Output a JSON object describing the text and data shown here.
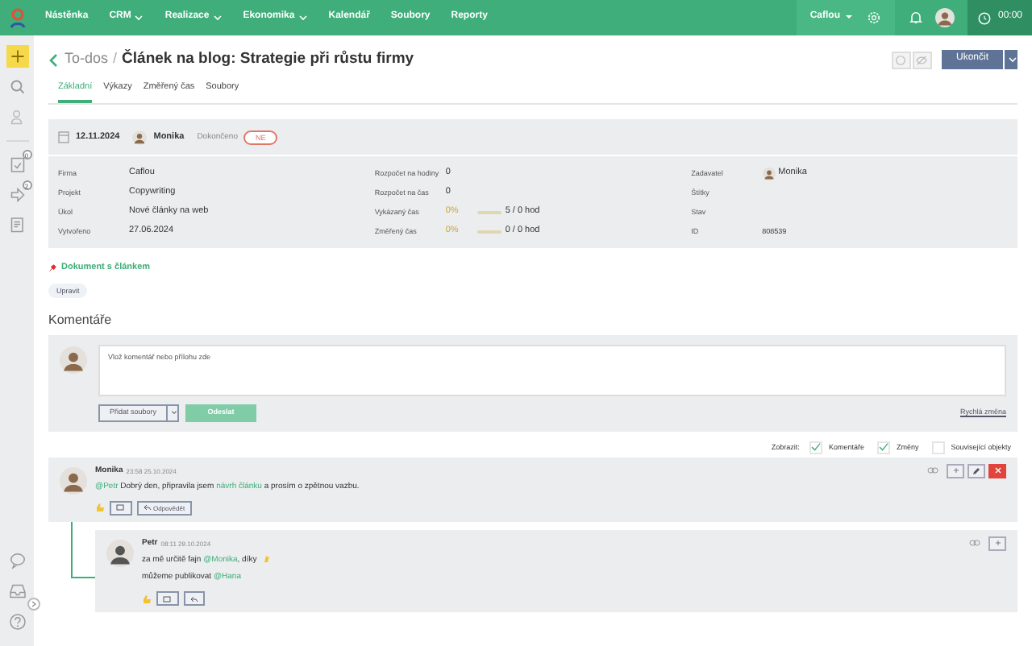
{
  "nav": {
    "items": [
      {
        "label": "Nástěnka",
        "dropdown": false
      },
      {
        "label": "CRM",
        "dropdown": true
      },
      {
        "label": "Realizace",
        "dropdown": true
      },
      {
        "label": "Ekonomika",
        "dropdown": true
      },
      {
        "label": "Kalendář",
        "dropdown": false
      },
      {
        "label": "Soubory",
        "dropdown": false
      },
      {
        "label": "Reporty",
        "dropdown": false
      }
    ],
    "company": "Caflou",
    "timer": "00:00"
  },
  "sidebar": {
    "badges": [
      "0",
      "2"
    ]
  },
  "breadcrumb": {
    "parent": "To-dos",
    "separator": "/",
    "title": "Článek na blog: Strategie při růstu firmy"
  },
  "primary_button": "Ukončit",
  "tabs": [
    {
      "label": "Základní",
      "selected": true
    },
    {
      "label": "Výkazy",
      "selected": false
    },
    {
      "label": "Změřený čas",
      "selected": false
    },
    {
      "label": "Soubory",
      "selected": false
    }
  ],
  "summary": {
    "date": "12.11.2024",
    "assignee": "Monika",
    "done_label": "Dokončeno",
    "done_value": "NE",
    "done": false
  },
  "details": [
    [
      {
        "label": "Firma",
        "kind": "text",
        "value": "Caflou"
      },
      {
        "label": "Projekt",
        "kind": "text",
        "value": "Copywriting"
      },
      {
        "label": "Úkol",
        "kind": "text",
        "value": "Nové články na web"
      },
      {
        "label": "Vytvořeno",
        "kind": "text",
        "value": "27.06.2024"
      }
    ],
    [
      {
        "label": "Rozpočet na hodiny",
        "kind": "text",
        "value": "0"
      },
      {
        "label": "Rozpočet na čas",
        "kind": "text",
        "value": "0"
      },
      {
        "label": "Vykázaný čas",
        "kind": "progress",
        "percent": "0%",
        "level": 0,
        "value": "5 / 0 hod"
      },
      {
        "label": "Změřený čas",
        "kind": "progress",
        "percent": "0%",
        "level": 0,
        "value": "0 / 0 hod"
      }
    ],
    [
      {
        "label": "Zadavatel",
        "kind": "person",
        "value": "Monika"
      },
      {
        "label": "Štítky",
        "kind": "text"
      },
      {
        "label": "Stav",
        "kind": "text"
      },
      {
        "label": "ID",
        "kind": "small",
        "value": "808539"
      }
    ]
  ],
  "link": "Dokument s článkem",
  "edit_button": "Upravit",
  "comments_title": "Komentáře",
  "composer": {
    "placeholder": "Vlož komentář nebo přílohu zde",
    "add_files": "Přidat soubory",
    "send": "Odeslat",
    "quick_change": "Rychlá změna"
  },
  "filter": {
    "label": "Zobrazit:",
    "options": [
      {
        "label": "Komentáře",
        "checked": true
      },
      {
        "label": "Změny",
        "checked": true
      },
      {
        "label": "Související objekty",
        "checked": false
      }
    ]
  },
  "comments": [
    {
      "author": "Monika",
      "time": "23:58 25.10.2024",
      "deletable": true,
      "editable": true,
      "reply_label": "Odpovědět",
      "paragraphs": [
        [
          {
            "kind": "mention",
            "text": "@Petr"
          },
          {
            "kind": "text",
            "text": " Dobrý den, připravila jsem "
          },
          {
            "kind": "link",
            "text": "návrh článku"
          },
          {
            "kind": "text",
            "text": " a prosím o zpětnou vazbu."
          }
        ]
      ],
      "children": [
        {
          "author": "Petr",
          "time": "08:11 29.10.2024",
          "deletable": false,
          "editable": false,
          "paragraphs": [
            [
              {
                "kind": "text",
                "text": "za mě určitě fajn "
              },
              {
                "kind": "mention",
                "text": "@Monika"
              },
              {
                "kind": "text",
                "text": ", díky "
              },
              {
                "kind": "emoji"
              }
            ],
            [
              {
                "kind": "text",
                "text": "můžeme publikovat "
              },
              {
                "kind": "mention",
                "text": "@Hana"
              }
            ]
          ]
        }
      ]
    }
  ]
}
